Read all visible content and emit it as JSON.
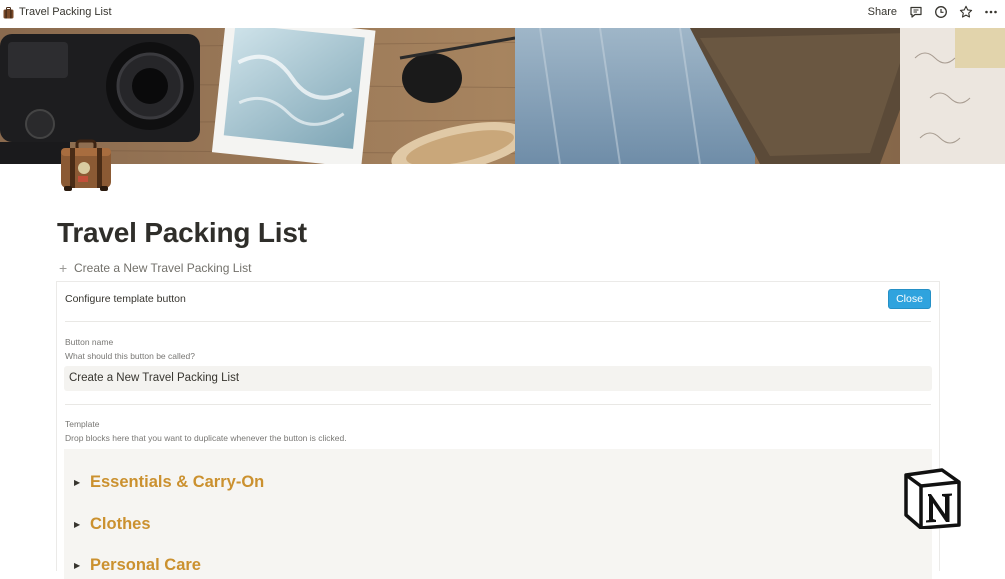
{
  "topbar": {
    "breadcrumb": "Travel Packing List",
    "share_label": "Share",
    "icons": [
      "comment-icon",
      "history-icon",
      "star-icon",
      "more-icon"
    ]
  },
  "page": {
    "title": "Travel Packing List",
    "icon": "suitcase-icon"
  },
  "template_button": {
    "label": "Create a New Travel Packing List"
  },
  "config_panel": {
    "heading": "Configure template button",
    "close_label": "Close",
    "button_name_label": "Button name",
    "button_name_hint": "What should this button be called?",
    "button_name_value": "Create a New Travel Packing List",
    "template_label": "Template",
    "template_hint": "Drop blocks here that you want to duplicate whenever the button is clicked.",
    "toggles": [
      {
        "label": "Essentials & Carry-On"
      },
      {
        "label": "Clothes"
      },
      {
        "label": "Personal Care"
      }
    ]
  },
  "colors": {
    "accent": "#2fa3de",
    "heading_gold": "#cb912f",
    "template_bg": "#f6f5f2"
  }
}
